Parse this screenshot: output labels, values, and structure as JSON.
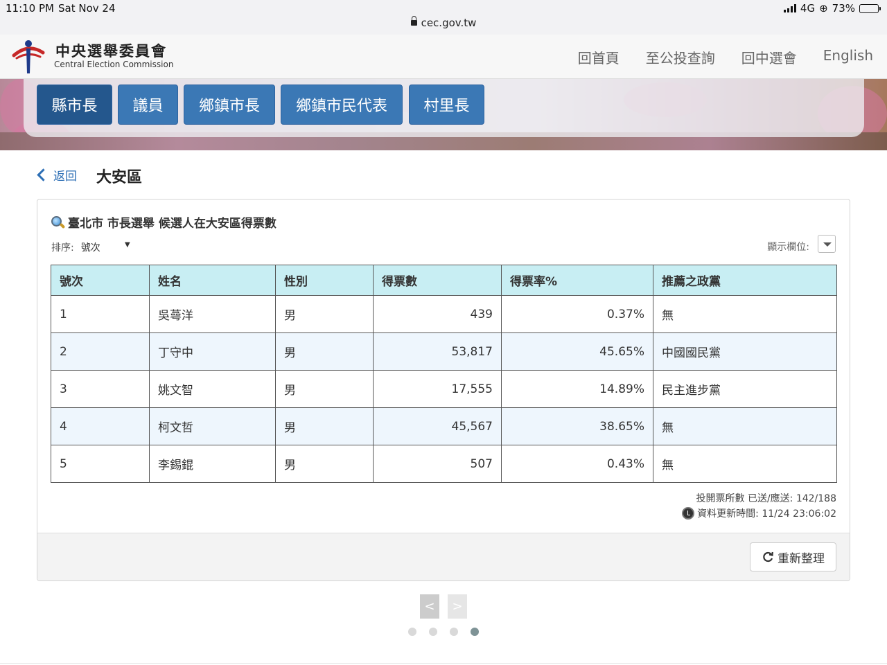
{
  "status_bar": {
    "time": "11:10 PM",
    "date": "Sat Nov 24",
    "url": "cec.gov.tw",
    "network": "4G",
    "battery": "73%",
    "battery_level": 0.73
  },
  "header": {
    "logo_zh": "中央選舉委員會",
    "logo_en": "Central Election Commission",
    "nav": [
      "回首頁",
      "至公投查詢",
      "回中選會",
      "English"
    ]
  },
  "tabs": [
    "縣市長",
    "議員",
    "鄉鎮市長",
    "鄉鎮市民代表",
    "村里長"
  ],
  "active_tab": "縣市長",
  "breadcrumb": {
    "back_label": "返回",
    "page_title": "大安區"
  },
  "card": {
    "title": "臺北市 市長選舉 候選人在大安區得票數",
    "sort_label": "排序:",
    "sort_value": "號次",
    "columns_label": "顯示欄位:",
    "table": {
      "headers": [
        "號次",
        "姓名",
        "性別",
        "得票數",
        "得票率%",
        "推薦之政黨"
      ],
      "rows": [
        [
          "1",
          "吳蕚洋",
          "男",
          "439",
          "0.37%",
          "無"
        ],
        [
          "2",
          "丁守中",
          "男",
          "53,817",
          "45.65%",
          "中國國民黨"
        ],
        [
          "3",
          "姚文智",
          "男",
          "17,555",
          "14.89%",
          "民主進步黨"
        ],
        [
          "4",
          "柯文哲",
          "男",
          "45,567",
          "38.65%",
          "無"
        ],
        [
          "5",
          "李錫錕",
          "男",
          "507",
          "0.43%",
          "無"
        ]
      ]
    },
    "stations_text": "投開票所數 已送/應送: 142/188",
    "update_text": "資料更新時間: 11/24 23:06:02",
    "refresh_label": "重新整理"
  },
  "pager": {
    "prev": "<",
    "next": ">",
    "dots": 4,
    "active_dot": 4
  },
  "colors": {
    "tab_blue": "#3b78b5",
    "table_header": "#c8eef3",
    "link": "#2d6fb5"
  }
}
